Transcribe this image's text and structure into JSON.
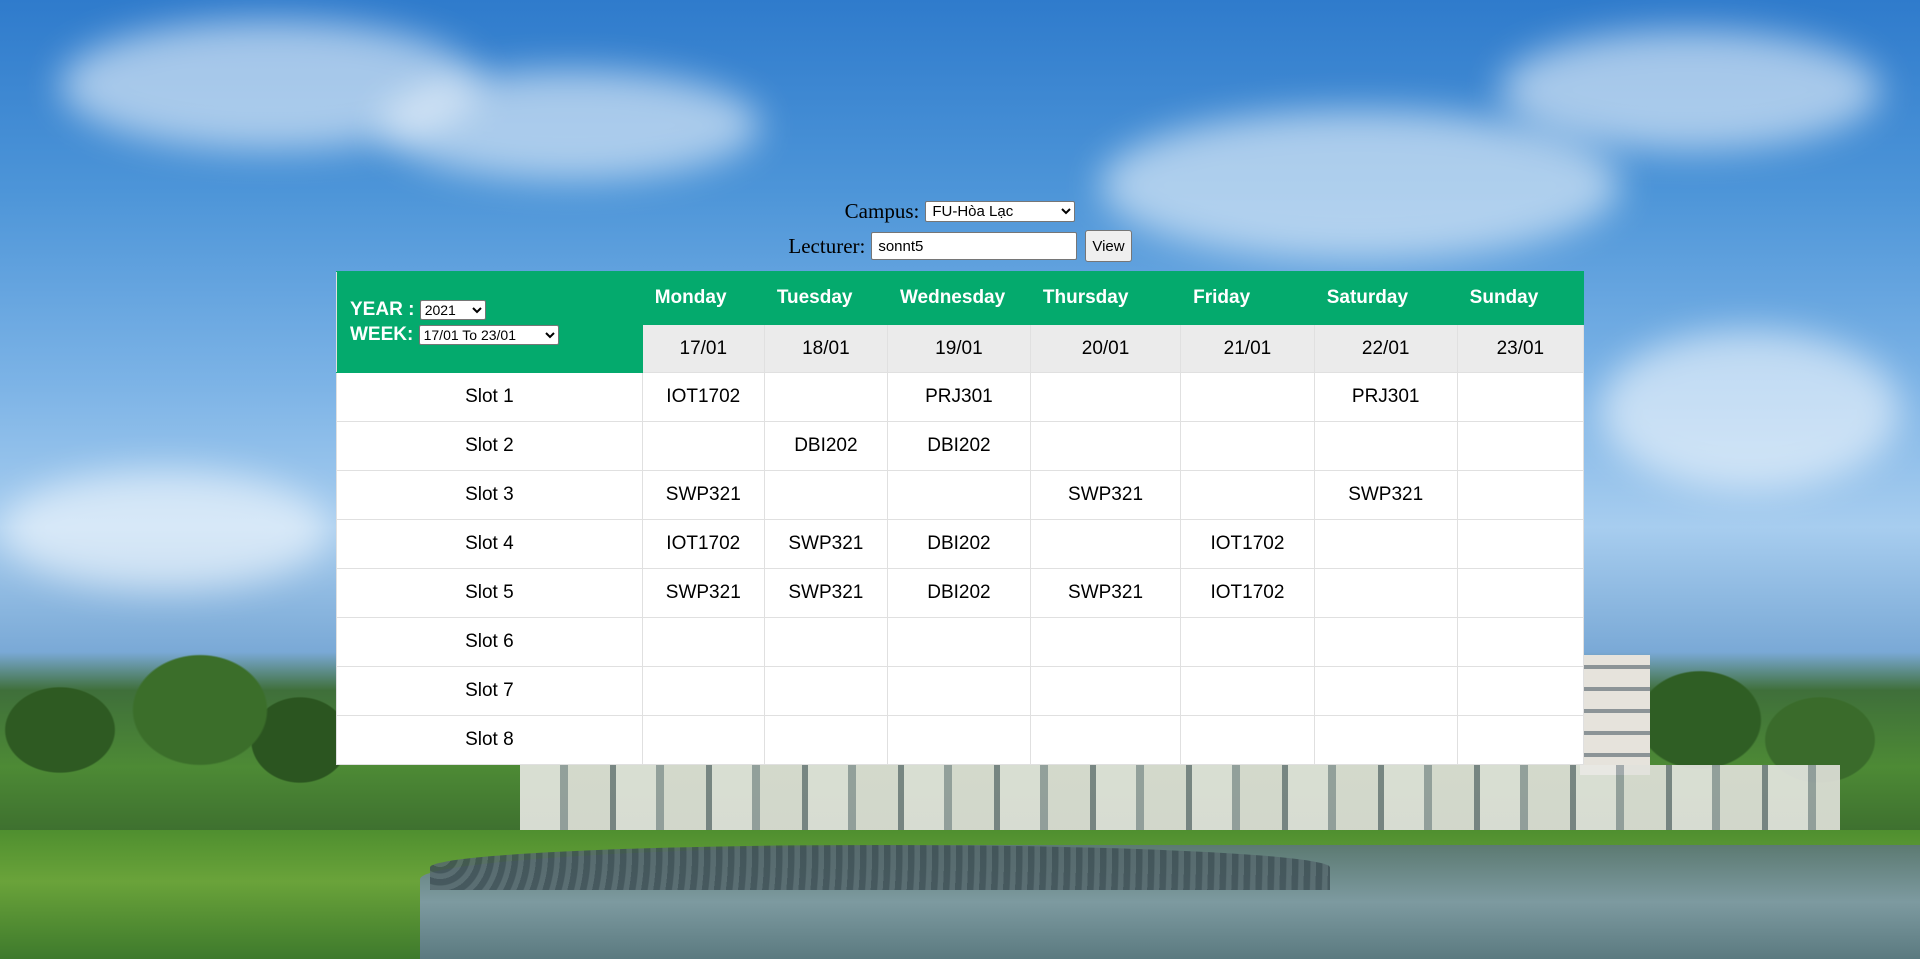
{
  "filters": {
    "campus_label": "Campus:",
    "campus_selected": "FU-Hòa Lạc",
    "lecturer_label": "Lecturer:",
    "lecturer_value": "sonnt5",
    "view_label": "View"
  },
  "timetable": {
    "year_label": "YEAR :",
    "year_selected": "2021",
    "week_label": "WEEK:",
    "week_selected": "17/01 To 23/01",
    "days": [
      "Monday",
      "Tuesday",
      "Wednesday",
      "Thursday",
      "Friday",
      "Saturday",
      "Sunday"
    ],
    "dates": [
      "17/01",
      "18/01",
      "19/01",
      "20/01",
      "21/01",
      "22/01",
      "23/01"
    ],
    "slots": [
      {
        "label": "Slot 1",
        "cells": [
          "IOT1702",
          "",
          "PRJ301",
          "",
          "",
          "PRJ301",
          ""
        ]
      },
      {
        "label": "Slot 2",
        "cells": [
          "",
          "DBI202",
          "DBI202",
          "",
          "",
          "",
          ""
        ]
      },
      {
        "label": "Slot 3",
        "cells": [
          "SWP321",
          "",
          "",
          "SWP321",
          "",
          "SWP321",
          ""
        ]
      },
      {
        "label": "Slot 4",
        "cells": [
          "IOT1702",
          "SWP321",
          "DBI202",
          "",
          "IOT1702",
          "",
          ""
        ]
      },
      {
        "label": "Slot 5",
        "cells": [
          "SWP321",
          "SWP321",
          "DBI202",
          "SWP321",
          "IOT1702",
          "",
          ""
        ]
      },
      {
        "label": "Slot 6",
        "cells": [
          "",
          "",
          "",
          "",
          "",
          "",
          ""
        ]
      },
      {
        "label": "Slot 7",
        "cells": [
          "",
          "",
          "",
          "",
          "",
          "",
          ""
        ]
      },
      {
        "label": "Slot 8",
        "cells": [
          "",
          "",
          "",
          "",
          "",
          "",
          ""
        ]
      }
    ]
  },
  "colors": {
    "header_green": "#04aa6d",
    "date_row_gray": "#ebebeb"
  }
}
